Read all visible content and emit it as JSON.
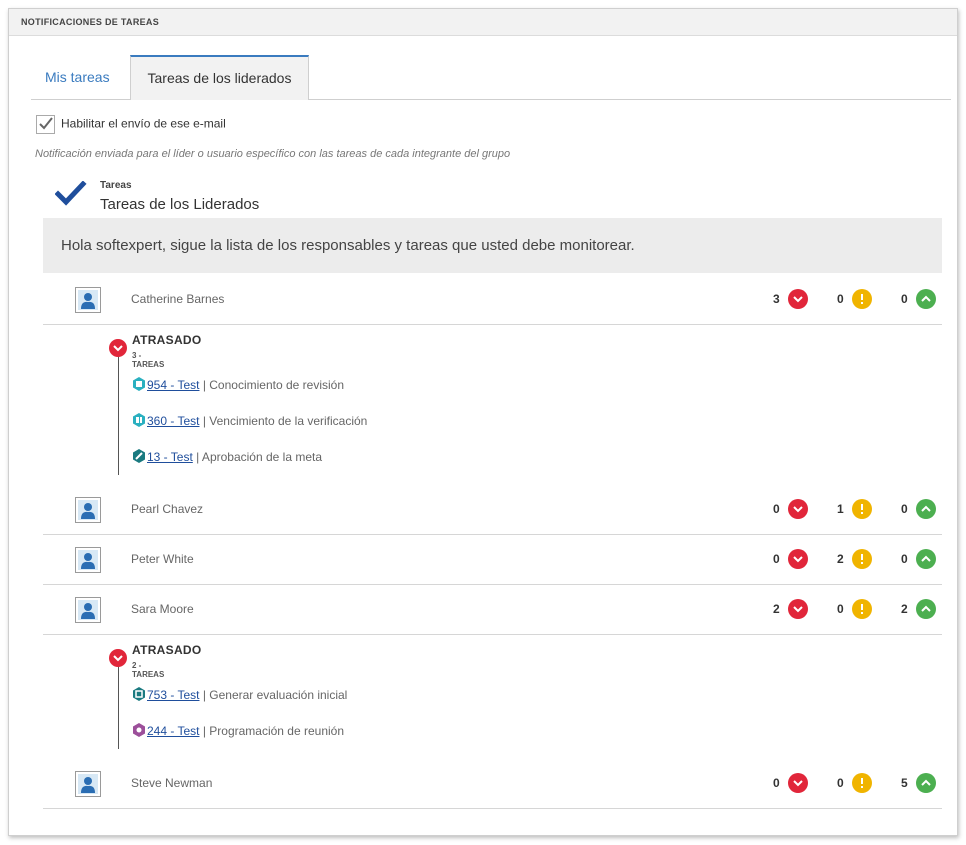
{
  "header": {
    "title": "NOTIFICACIONES DE TAREAS"
  },
  "tabs": [
    {
      "label": "Mis tareas"
    },
    {
      "label": "Tareas de los liderados"
    }
  ],
  "enable_email": {
    "label": "Habilitar el envío de ese e-mail",
    "checked": true
  },
  "note": "Notificación enviada para el líder o usuario específico con las tareas de cada integrante del grupo",
  "email": {
    "kicker": "Tareas",
    "title": "Tareas de los Liderados",
    "greeting": "Hola softexpert, sigue la lista de los responsables y tareas que usted debe monitorear."
  },
  "people": [
    {
      "name": "Catherine Barnes",
      "late": "3",
      "warning": "0",
      "ontime": "0"
    },
    {
      "name": "Pearl Chavez",
      "late": "0",
      "warning": "1",
      "ontime": "0"
    },
    {
      "name": "Peter White",
      "late": "0",
      "warning": "2",
      "ontime": "0"
    },
    {
      "name": "Sara Moore",
      "late": "2",
      "warning": "0",
      "ontime": "2"
    },
    {
      "name": "Steve Newman",
      "late": "0",
      "warning": "0",
      "ontime": "5"
    }
  ],
  "details": [
    {
      "status": "ATRASADO",
      "count": "3 - TAREAS",
      "tasks": [
        {
          "link": "954 - Test",
          "desc": " | Conocimiento de revisión",
          "icon": "document-icon",
          "color": "#2ab0c0"
        },
        {
          "link": "360 - Test",
          "desc": " | Vencimiento de la verificación",
          "icon": "verification-icon",
          "color": "#2ab0c0"
        },
        {
          "link": "13 - Test",
          "desc": " | Aprobación de la meta",
          "icon": "goal-icon",
          "color": "#1a7a80"
        }
      ]
    },
    {
      "status": "ATRASADO",
      "count": "2 - TAREAS",
      "tasks": [
        {
          "link": "753 - Test",
          "desc": " | Generar evaluación inicial",
          "icon": "evaluation-icon",
          "color": "#1a7a80"
        },
        {
          "link": "244 - Test",
          "desc": " | Programación de reunión",
          "icon": "meeting-icon",
          "color": "#9c4f9a"
        }
      ]
    }
  ],
  "colors": {
    "late": "#e1263a",
    "warning": "#f0b400",
    "ontime": "#4caf50",
    "accent": "#3a7bbf"
  }
}
